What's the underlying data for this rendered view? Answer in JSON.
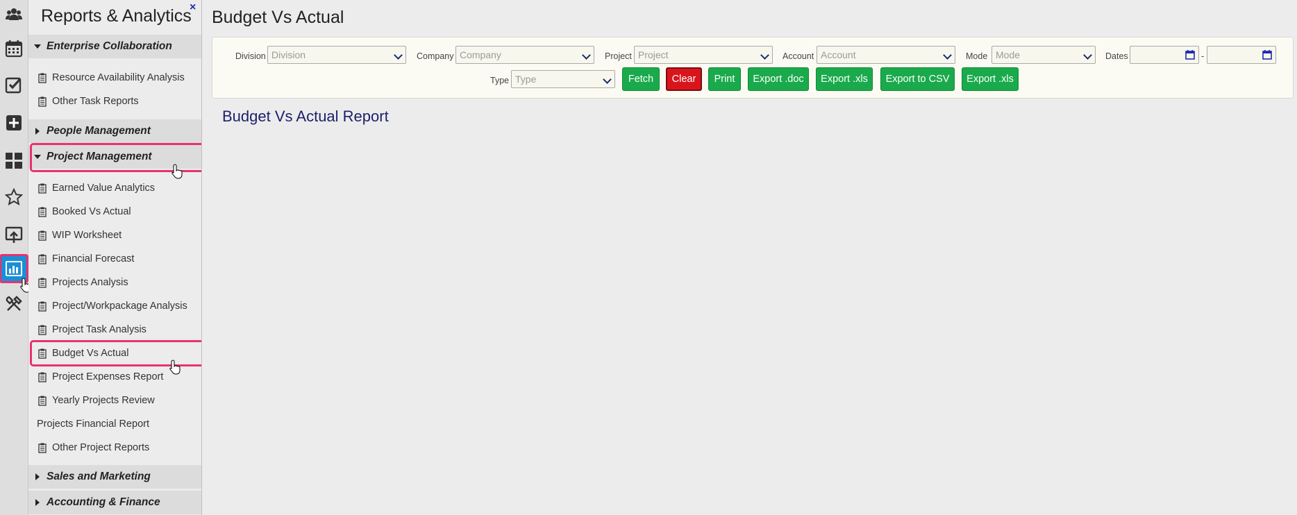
{
  "rail": {
    "icons": [
      "people-icon",
      "calendar-icon",
      "checklist-icon",
      "plus-icon",
      "dashboard-icon",
      "star-icon",
      "upload-icon",
      "chart-icon",
      "tools-icon"
    ],
    "active": "chart-icon",
    "accent": "#1a8fd6"
  },
  "menu": {
    "title": "Reports & Analytics",
    "close": "×",
    "sections": {
      "enterprise": "Enterprise Collaboration",
      "people": "People Management",
      "project": "Project Management",
      "sales": "Sales and Marketing",
      "accounting": "Accounting & Finance"
    },
    "enterprise_items": [
      "Resource Availability Analysis",
      "Other Task Reports"
    ],
    "project_items": [
      "Earned Value Analytics",
      "Booked Vs Actual",
      "WIP Worksheet",
      "Financial Forecast",
      "Projects Analysis",
      "Project/Workpackage Analysis",
      "Project Task Analysis",
      "Budget Vs Actual",
      "Project Expenses Report",
      "Yearly Projects Review",
      "Projects Financial Report",
      "Other Project Reports"
    ]
  },
  "page": {
    "title": "Budget Vs Actual",
    "report_title": "Budget Vs Actual Report"
  },
  "filters": {
    "division_label": "Division",
    "division_placeholder": "Division",
    "company_label": "Company",
    "company_placeholder": "Company",
    "project_label": "Project",
    "project_placeholder": "Project",
    "account_label": "Account",
    "account_placeholder": "Account",
    "mode_label": "Mode",
    "mode_placeholder": "Mode",
    "dates_label": "Dates",
    "dates_separator": "-",
    "type_label": "Type",
    "type_placeholder": "Type"
  },
  "buttons": {
    "fetch": "Fetch",
    "clear": "Clear",
    "print": "Print",
    "export_doc": "Export .doc",
    "export_xls": "Export .xls",
    "export_csv": "Export to CSV",
    "export_xls2": "Export .xls"
  },
  "colors": {
    "green": "#1aaa4c",
    "red": "#d9151c",
    "highlight": "#e8326f",
    "report_title": "#1c1f6b"
  }
}
